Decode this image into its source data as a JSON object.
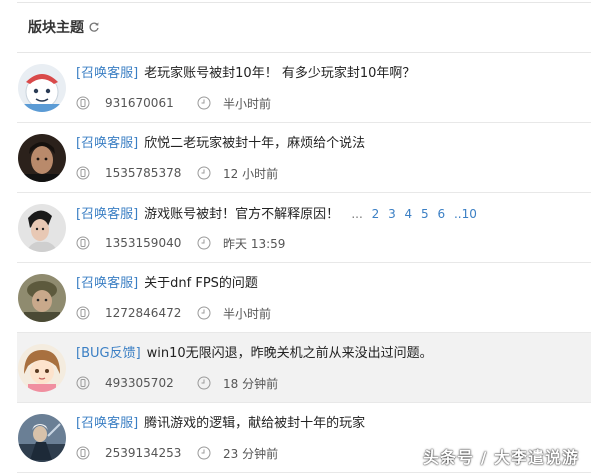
{
  "section": {
    "title": "版块主题",
    "refresh_icon": "refresh-icon"
  },
  "threads": [
    {
      "tag": "[召唤客服]",
      "title": "老玩家账号被封10年！ 有多少玩家封10年啊？",
      "views": "931670061",
      "time": "半小时前",
      "pages": [],
      "highlighted": false,
      "avatar": "avatar-cartoon-kid"
    },
    {
      "tag": "[召唤客服]",
      "title": "欣悦二老玩家被封十年，麻烦给个说法",
      "views": "1535785378",
      "time": "12 小时前",
      "pages": [],
      "highlighted": false,
      "avatar": "avatar-man-portrait"
    },
    {
      "tag": "[召唤客服]",
      "title": "游戏账号被封！官方不解释原因！",
      "views": "1353159040",
      "time": "昨天 13:59",
      "pages": [
        "...",
        "2",
        "3",
        "4",
        "5",
        "6",
        "..10"
      ],
      "highlighted": false,
      "avatar": "avatar-woman"
    },
    {
      "tag": "[召唤客服]",
      "title": "关于dnf FPS的问题",
      "views": "1272846472",
      "time": "半小时前",
      "pages": [],
      "highlighted": false,
      "avatar": "avatar-soldier"
    },
    {
      "tag": "[BUG反馈]",
      "title": "win10无限闪退，昨晚关机之前从来没出过问题。",
      "views": "493305702",
      "time": "18 分钟前",
      "pages": [],
      "highlighted": true,
      "avatar": "avatar-anime-girl"
    },
    {
      "tag": "[召唤客服]",
      "title": "腾讯游戏的逻辑，献给被封十年的玩家",
      "views": "2539134253",
      "time": "23 分钟前",
      "pages": [],
      "highlighted": false,
      "avatar": "avatar-game-character"
    }
  ],
  "icons": {
    "views": "views-icon",
    "time": "clock-icon"
  },
  "watermark": "头条号 / 大李遣说游"
}
